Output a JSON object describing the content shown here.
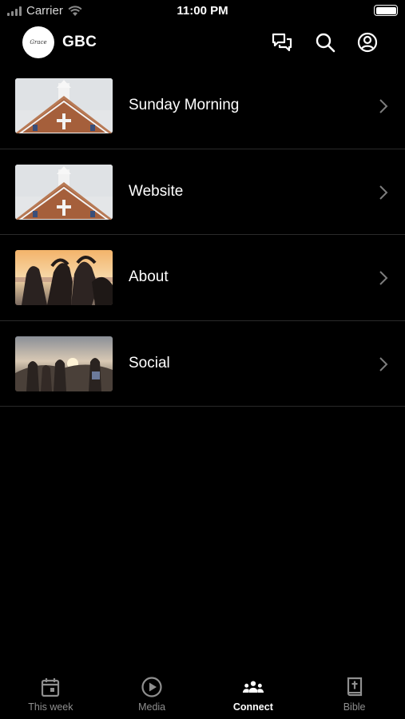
{
  "status_bar": {
    "carrier": "Carrier",
    "time": "11:00 PM"
  },
  "header": {
    "title": "GBC",
    "logo_text": "Grace"
  },
  "items": [
    {
      "label": "Sunday Morning",
      "thumbnail": "church-steeple"
    },
    {
      "label": "Website",
      "thumbnail": "church-steeple"
    },
    {
      "label": "About",
      "thumbnail": "friends-hearts-sunset"
    },
    {
      "label": "Social",
      "thumbnail": "friends-sunset-hills"
    }
  ],
  "tabs": [
    {
      "label": "This week",
      "icon": "calendar-icon",
      "active": false
    },
    {
      "label": "Media",
      "icon": "play-circle-icon",
      "active": false
    },
    {
      "label": "Connect",
      "icon": "people-icon",
      "active": true
    },
    {
      "label": "Bible",
      "icon": "bible-icon",
      "active": false
    }
  ],
  "colors": {
    "background": "#000000",
    "text": "#ffffff",
    "inactive_tab": "#8f8f8f",
    "divider": "#2a2a2a"
  }
}
